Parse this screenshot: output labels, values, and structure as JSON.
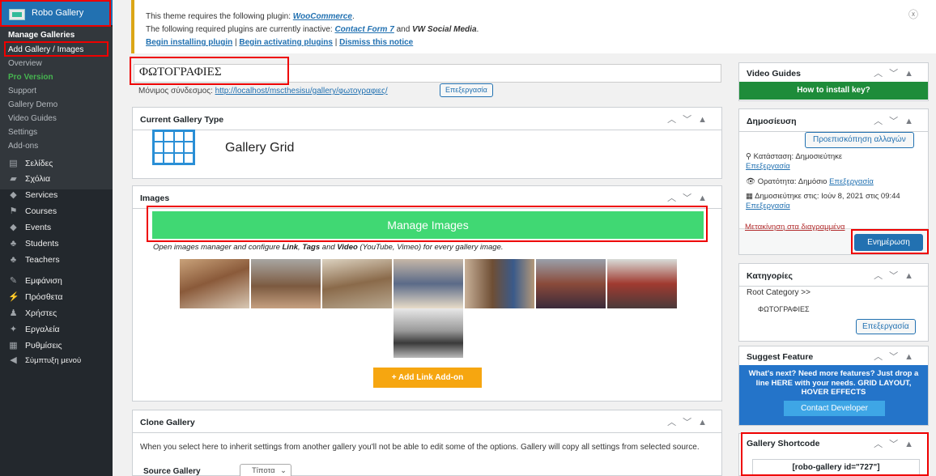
{
  "sidebar": {
    "active_item": "Robo Gallery",
    "submenu": [
      "Manage Galleries",
      "Add Gallery / Images",
      "Overview",
      "Pro Version",
      "Support",
      "Gallery Demo",
      "Video Guides",
      "Settings",
      "Add-ons"
    ],
    "menu": [
      {
        "label": "Σελίδες",
        "icon": "pages-icon"
      },
      {
        "label": "Σχόλια",
        "icon": "comments-icon"
      },
      {
        "label": "Services",
        "icon": "services-icon"
      },
      {
        "label": "Courses",
        "icon": "courses-icon"
      },
      {
        "label": "Events",
        "icon": "events-icon"
      },
      {
        "label": "Students",
        "icon": "students-icon"
      },
      {
        "label": "Teachers",
        "icon": "teachers-icon"
      },
      {
        "label": "Εμφάνιση",
        "icon": "appearance-icon"
      },
      {
        "label": "Πρόσθετα",
        "icon": "plugins-icon"
      },
      {
        "label": "Χρήστες",
        "icon": "users-icon"
      },
      {
        "label": "Εργαλεία",
        "icon": "tools-icon"
      },
      {
        "label": "Ρυθμίσεις",
        "icon": "settings-icon"
      },
      {
        "label": "Σύμπτυξη μενού",
        "icon": "collapse-icon"
      }
    ]
  },
  "notice": {
    "line1_prefix": "This theme requires the following plugin: ",
    "line1_link": "WooCommerce",
    "line1_suffix": ".",
    "line2_prefix": "The following required plugins are currently inactive: ",
    "line2_link": "Contact Form 7",
    "line2_mid": " and ",
    "line2_bold": "VW Social Media",
    "line2_suffix": ".",
    "begin_install": "Begin installing plugin",
    "begin_activate": "Begin activating plugins",
    "dismiss": "Dismiss this notice",
    "sep": " | "
  },
  "post": {
    "title": "ΦΩΤΟΓΡΑΦΙΕΣ",
    "permalink_label": "Μόνιμος σύνδεσμος: ",
    "permalink_url": "http://localhost/mscthesisu/gallery/φωτογραφιες/",
    "permalink_edit": "Επεξεργασία"
  },
  "gallery_type": {
    "box_title": "Current Gallery Type",
    "label": "Gallery Grid"
  },
  "images": {
    "box_title": "Images",
    "manage_button": "Manage Images",
    "help_prefix": "Open images manager and configure ",
    "help_link": "Link",
    "help_sep1": ", ",
    "help_tags": "Tags",
    "help_and": " and ",
    "help_video": "Video",
    "help_suffix": " (YouTube, Vimeo) for every gallery image.",
    "add_link_button": "+ Add Link Add-on"
  },
  "clone": {
    "box_title": "Clone Gallery",
    "description": "When you select here to inherit settings from another gallery you'll not be able to edit some of the options. Gallery will copy all settings from selected source.",
    "source_label": "Source Gallery",
    "source_value": "Τίποτα"
  },
  "video_guides": {
    "box_title": "Video Guides",
    "button": "How to install key?"
  },
  "publish": {
    "box_title": "Δημοσίευση",
    "preview_button": "Προεπισκόπηση αλλαγών",
    "status_label": "Κατάσταση: ",
    "status_value": "Δημοσιεύτηκε",
    "status_edit": "Επεξεργασία",
    "visibility_label": "Ορατότητα: ",
    "visibility_value": "Δημόσιο",
    "visibility_edit": "Επεξεργασία",
    "published_label": "Δημοσιεύτηκε στις: ",
    "published_value": "Ιούν 8, 2021 στις 09:44",
    "published_edit": "Επεξεργασία",
    "trash": "Μετακίνηση στα διαγραμμένα",
    "update_button": "Ενημέρωση"
  },
  "categories": {
    "box_title": "Κατηγορίες",
    "root": "Root Category >>",
    "item": "ΦΩΤΟΓΡΑΦΙΕΣ",
    "edit_button": "Επεξεργασία"
  },
  "suggest": {
    "box_title": "Suggest Feature",
    "text": "What's next? Need more features? Just drop a line HERE with your needs. GRID LAYOUT, HOVER EFFECTS",
    "button": "Contact Developer"
  },
  "shortcode": {
    "box_title": "Gallery Shortcode",
    "value": "[robo-gallery id=\"727\"]"
  },
  "colors": {
    "admin_sidebar": "#23282d",
    "active_blue": "#2271b1",
    "manage_green": "#40d873",
    "add_link_orange": "#f6a610",
    "highlight_red": "#e00000"
  }
}
